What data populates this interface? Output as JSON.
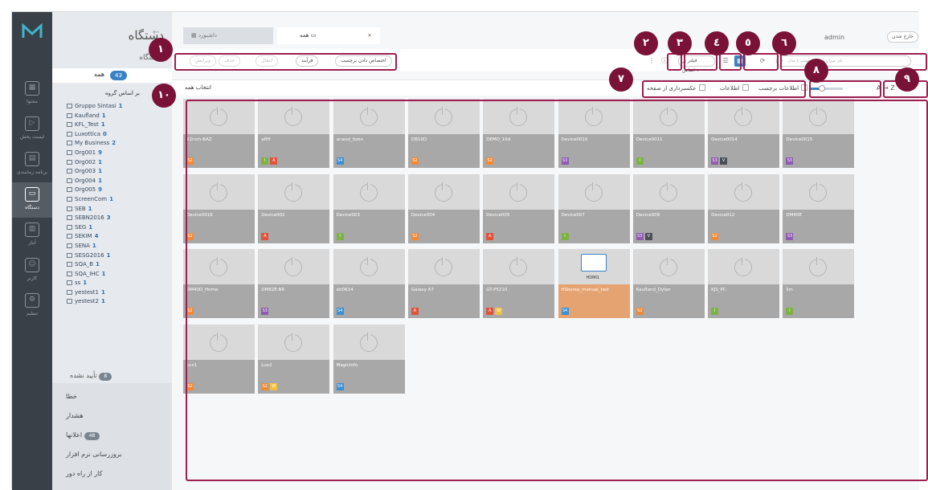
{
  "rail": {
    "items": [
      {
        "label": "محتوا",
        "icon": "grid-icon"
      },
      {
        "label": "لیست پخش",
        "icon": "playlist-icon"
      },
      {
        "label": "برنامه زمانبندی",
        "icon": "calendar-icon"
      },
      {
        "label": "دستگاه",
        "icon": "device-icon"
      },
      {
        "label": "آمار",
        "icon": "chart-icon"
      },
      {
        "label": "کاربر",
        "icon": "user-icon"
      },
      {
        "label": "تنظیم",
        "icon": "settings-icon"
      }
    ]
  },
  "tree": {
    "title": "دستگاه",
    "subtitle": "دستگاه",
    "all_label": "همه",
    "all_count": "43",
    "group_title": "بر اساس گروه",
    "groups": [
      {
        "name": "Gruppo Sintasi",
        "count": "1"
      },
      {
        "name": "Kaufland",
        "count": "1"
      },
      {
        "name": "KFL_Test",
        "count": "1"
      },
      {
        "name": "Luxottica",
        "count": "0"
      },
      {
        "name": "My Business",
        "count": "2"
      },
      {
        "name": "Org001",
        "count": "9"
      },
      {
        "name": "Org002",
        "count": "1"
      },
      {
        "name": "Org003",
        "count": "1"
      },
      {
        "name": "Org004",
        "count": "1"
      },
      {
        "name": "Org005",
        "count": "9"
      },
      {
        "name": "ScreenCom",
        "count": "1"
      },
      {
        "name": "SEB",
        "count": "1"
      },
      {
        "name": "SEBN2016",
        "count": "3"
      },
      {
        "name": "SEG",
        "count": "1"
      },
      {
        "name": "SEKIM",
        "count": "4"
      },
      {
        "name": "SENA",
        "count": "1"
      },
      {
        "name": "SESG2016",
        "count": "1"
      },
      {
        "name": "SQA_B",
        "count": "1"
      },
      {
        "name": "SQA_IHC",
        "count": "1"
      },
      {
        "name": "ss",
        "count": "1"
      },
      {
        "name": "yestest1",
        "count": "1"
      },
      {
        "name": "yestest2",
        "count": "1"
      }
    ],
    "unapproved_label": "تأیید نشده",
    "unapproved_count": "8",
    "bottom": [
      {
        "label": "خطا"
      },
      {
        "label": "هشدار"
      },
      {
        "label": "اعلانها",
        "count": "48"
      },
      {
        "label": "بروزرسانی نرم افزار"
      },
      {
        "label": "کار از راه دور"
      }
    ]
  },
  "tabs": [
    {
      "label": "داشبورد",
      "icon": "dashboard-icon"
    },
    {
      "label": "همه",
      "icon": "monitor-icon",
      "close": "×"
    }
  ],
  "user": {
    "name": "admin",
    "logout": "خارج شدن"
  },
  "toolbar": {
    "buttons": [
      "اختصاص دادن برچسب",
      "فرآیند",
      "انتقال",
      "حذف",
      "ویرایش"
    ],
    "search_placeholder": "نام، میزان افزار، برچسب یا مدل",
    "filter_label": "فیلتر بر اساس"
  },
  "subbar": {
    "select_all": "انتخاب همه",
    "checks": [
      "عکسبرداری از صفحه",
      "اطلاعات",
      "اطلاعات برچسب"
    ],
    "sort": "A → Z",
    "thumb_size": 0.35
  },
  "devices": [
    {
      "name": "22inch-BAZ",
      "badges": [
        "S2"
      ]
    },
    {
      "name": "affff",
      "badges": [
        "I",
        "A"
      ]
    },
    {
      "name": "anand_tizen",
      "badges": [
        "S4"
      ]
    },
    {
      "name": "DB10D",
      "badges": [
        "S2"
      ]
    },
    {
      "name": "DEMO_10d",
      "badges": [
        "S2"
      ]
    },
    {
      "name": "Device0010",
      "badges": [
        "S3"
      ]
    },
    {
      "name": "Device0011",
      "badges": [
        "I"
      ]
    },
    {
      "name": "Device0014",
      "badges": [
        "S3",
        "V"
      ]
    },
    {
      "name": "Device0015",
      "badges": [
        "S3"
      ]
    },
    {
      "name": "Device0016",
      "badges": [
        "S2"
      ]
    },
    {
      "name": "Device002",
      "badges": [
        "A"
      ]
    },
    {
      "name": "Device003",
      "badges": [
        "I"
      ]
    },
    {
      "name": "Device004",
      "badges": [
        "S2"
      ]
    },
    {
      "name": "Device005",
      "badges": [
        "A"
      ]
    },
    {
      "name": "Device007",
      "badges": [
        "I"
      ]
    },
    {
      "name": "Device009",
      "badges": [
        "S3",
        "V"
      ]
    },
    {
      "name": "Device012",
      "badges": [
        "S2"
      ]
    },
    {
      "name": "DM40E",
      "badges": [
        "S3"
      ]
    },
    {
      "name": "DM40D_Home",
      "badges": [
        "S2"
      ]
    },
    {
      "name": "DM82E-BR",
      "badges": [
        "S3"
      ]
    },
    {
      "name": "eb0614",
      "badges": [
        "S4"
      ]
    },
    {
      "name": "Galaxy A7",
      "badges": [
        "A"
      ]
    },
    {
      "name": "GT-P5210",
      "badges": [
        "A",
        "W"
      ]
    },
    {
      "name": "HSkorea_manual_test",
      "badges": [
        "S4"
      ],
      "highlight": true,
      "source": "HDMI1"
    },
    {
      "name": "Kaufland_Dylan",
      "badges": [
        "S2"
      ]
    },
    {
      "name": "KJS_PC",
      "badges": [
        "I"
      ]
    },
    {
      "name": "lim",
      "badges": [
        "I"
      ]
    },
    {
      "name": "Lux1",
      "badges": [
        "S2"
      ]
    },
    {
      "name": "Lux2",
      "badges": [
        "S2",
        "W"
      ]
    },
    {
      "name": "MagicInfo",
      "badges": [
        "S4"
      ]
    }
  ],
  "callouts": [
    "١",
    "٢",
    "٣",
    "٤",
    "٥",
    "٦",
    "٧",
    "٨",
    "٩",
    "١٠"
  ]
}
